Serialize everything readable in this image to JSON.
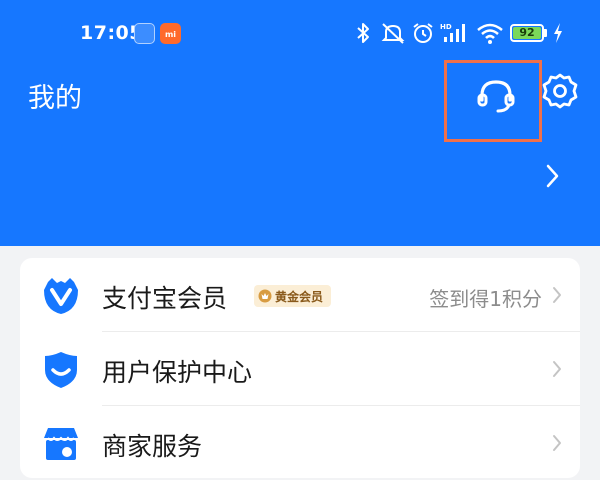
{
  "status_bar": {
    "time": "17:05",
    "battery": "92",
    "icons": [
      "notification-app-icon",
      "notification-mi-icon",
      "bluetooth-icon",
      "mute-icon",
      "alarm-icon",
      "signal-hd-icon",
      "wifi-icon",
      "charging-icon"
    ]
  },
  "header": {
    "title": "我的",
    "background": "#1677ff",
    "icons": [
      "customer-service-icon",
      "settings-icon",
      "chevron-right-icon"
    ]
  },
  "menu": {
    "items": [
      {
        "label": "支付宝会员",
        "badge": "黄金会员",
        "right_text": "签到得1积分",
        "icon": "member-icon",
        "icon_color": "#1677ff"
      },
      {
        "label": "用户保护中心",
        "icon": "shield-icon",
        "icon_color": "#1677ff"
      },
      {
        "label": "商家服务",
        "icon": "store-icon",
        "icon_color": "#1677ff"
      }
    ]
  }
}
